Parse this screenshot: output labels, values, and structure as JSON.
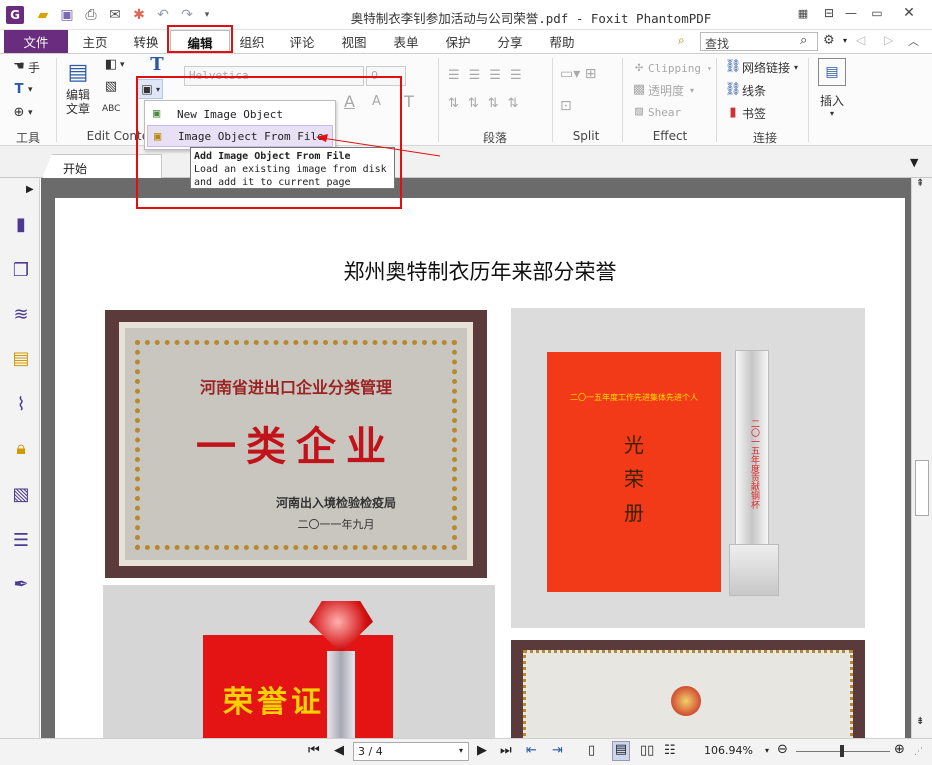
{
  "window": {
    "title": "奥特制衣李钊参加活动与公司荣誉.pdf - Foxit PhantomPDF"
  },
  "menu_tabs": [
    "文件",
    "主页",
    "转换",
    "编辑",
    "组织",
    "评论",
    "视图",
    "表单",
    "保护",
    "分享",
    "帮助"
  ],
  "active_tab": "编辑",
  "search": {
    "placeholder": "查找"
  },
  "ribbon": {
    "tools": {
      "hand": "手",
      "label": "工具"
    },
    "edit_content": {
      "edit_text": "编辑\n文章",
      "label": "Edit Content"
    },
    "font_name": "Helvetica",
    "paragraph_label": "段落",
    "split_label": "Split",
    "effect": {
      "clipping": "Clipping",
      "transparency": "透明度",
      "shear": "Shear",
      "label": "Effect"
    },
    "links": {
      "web_link": "网络链接",
      "line": "线条",
      "bookmark": "书签",
      "label": "连接"
    },
    "insert": {
      "label": "插入"
    }
  },
  "dropdown": {
    "items": [
      "New Image Object",
      "Image Object From File"
    ]
  },
  "tooltip": {
    "title": "Add Image Object From File",
    "body": "Load an existing image from disk and add it to current page"
  },
  "doc_tab": "开始",
  "document": {
    "heading": "郑州奥特制衣历年来部分荣誉",
    "plaque1": {
      "line1": "河南省进出口企业分类管理",
      "line2": "一类企业",
      "issuer": "河南出入境检验检疫局",
      "date": "二〇一一年九月"
    },
    "certificate": {
      "header": "二〇一五年度工作先进集体先进个人",
      "title": [
        "光",
        "荣",
        "册"
      ]
    },
    "trophy_text": "二〇一五年度贡献钢杯",
    "award": {
      "text": "荣誉证"
    }
  },
  "status": {
    "page": "3 / 4",
    "zoom": "106.94%"
  },
  "colors": {
    "accent": "#6a2c7e",
    "highlight_red": "#e01010"
  }
}
